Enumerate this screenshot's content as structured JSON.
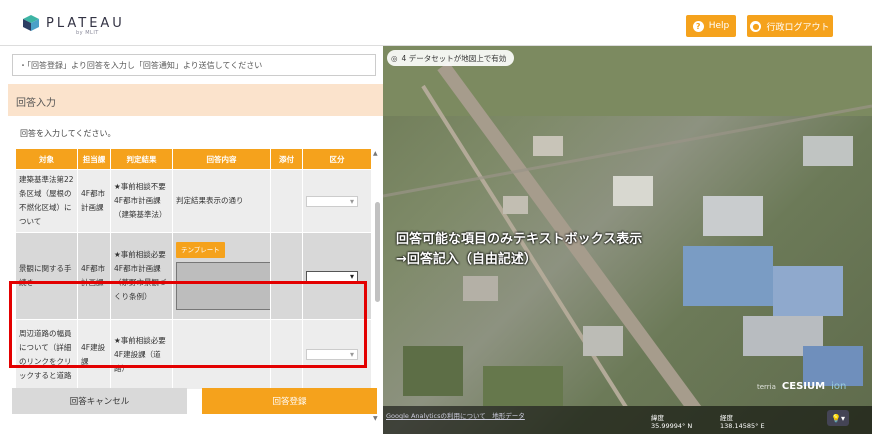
{
  "header": {
    "logo_text": "PLATEAU",
    "logo_sub": "by MLIT",
    "help_label": "Help",
    "logout_label": "行政ログアウト"
  },
  "panel": {
    "instruction": "・「回答登録」より回答を入力し「回答通知」より送信してください",
    "section_title": "回答入力",
    "prompt": "回答を入力してください。",
    "columns": [
      "対象",
      "担当課",
      "判定結果",
      "回答内容",
      "添付",
      "区分"
    ],
    "rows": [
      {
        "target": "建築基準法第22条区域（屋根の不燃化区域）について",
        "dept": "4F都市計画課",
        "result": "★事前相談不要 4F都市計画課（建築基準法）",
        "answer": "判定結果表示の通り",
        "attach": "",
        "category": ""
      },
      {
        "target": "景観に関する手続き",
        "dept": "4F都市計画課",
        "result": "★事前相談必要 4F都市計画課（茅野市景観づくり条例）",
        "answer": "",
        "template_label": "テンプレート",
        "attach": "",
        "category": ""
      },
      {
        "target": "周辺道路の幅員について（詳細のリンクをクリックすると道路",
        "dept": "4F建設課",
        "result": "★事前相談必要 4F建設課（道路）",
        "answer": "",
        "attach": "",
        "category": ""
      }
    ],
    "cancel_label": "回答キャンセル",
    "submit_label": "回答登録"
  },
  "map": {
    "dataset_info": "4 データセットが地図上で有効",
    "overlay_line1": "回答可能な項目のみテキストボックス表示",
    "overlay_line2": "→回答記入（自由記述）",
    "ga_link": "Google Analyticsの利用について　地形データ",
    "lat_label": "緯度",
    "lat_value": "35.99994° N",
    "lon_label": "経度",
    "lon_value": "138.14585° E",
    "brand_terria": "terria",
    "brand_cesium": "CESIUM",
    "brand_ion": "ion"
  },
  "colors": {
    "accent": "#f5a21c",
    "section_bg": "#fbe3cc",
    "highlight_border": "#e30000"
  }
}
